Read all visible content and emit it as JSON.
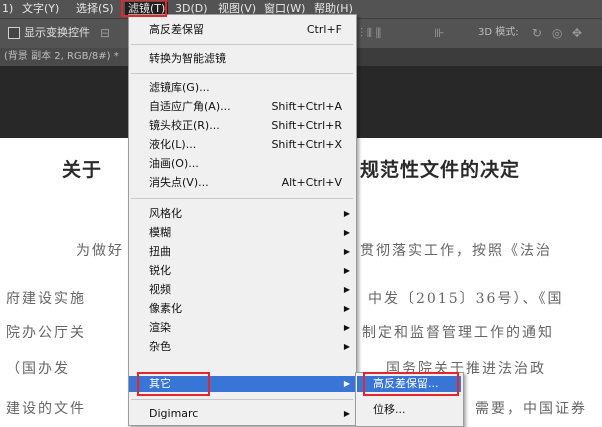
{
  "menubar": {
    "items": [
      "1)",
      "文字(Y)",
      "选择(S)",
      "滤镜(T)",
      "3D(D)",
      "视图(V)",
      "窗口(W)",
      "帮助(H)"
    ]
  },
  "options_bar": {
    "show_transform": "显示变换控件",
    "mode_label": "3D 模式:"
  },
  "doc_tab": "(背景 副本 2, RGB/8#) *",
  "document": {
    "title_left": "关于",
    "title_right": "规范性文件的决定",
    "lines": [
      {
        "left": "为做好",
        "right": "贯彻落实工作，按照《法治"
      },
      {
        "left": "府建设实施",
        "right": "中发〔2015〕36号）、《国"
      },
      {
        "left": "院办公厅关",
        "right": "制定和监督管理工作的通知"
      },
      {
        "left": "（国办发",
        "right": "国务院关于推进法治政"
      },
      {
        "left": "建设的文件",
        "right": "需要，中国证券"
      }
    ]
  },
  "filter_menu": {
    "items": [
      {
        "label": "高反差保留",
        "shortcut": "Ctrl+F"
      },
      {
        "label": "转换为智能滤镜"
      },
      {
        "label": "滤镜库(G)..."
      },
      {
        "label": "自适应广角(A)...",
        "shortcut": "Shift+Ctrl+A"
      },
      {
        "label": "镜头校正(R)...",
        "shortcut": "Shift+Ctrl+R"
      },
      {
        "label": "液化(L)...",
        "shortcut": "Shift+Ctrl+X"
      },
      {
        "label": "油画(O)..."
      },
      {
        "label": "消失点(V)...",
        "shortcut": "Alt+Ctrl+V"
      },
      {
        "label": "风格化",
        "submenu": true
      },
      {
        "label": "模糊",
        "submenu": true
      },
      {
        "label": "扭曲",
        "submenu": true
      },
      {
        "label": "锐化",
        "submenu": true
      },
      {
        "label": "视频",
        "submenu": true
      },
      {
        "label": "像素化",
        "submenu": true
      },
      {
        "label": "渲染",
        "submenu": true
      },
      {
        "label": "杂色",
        "submenu": true
      },
      {
        "label": "其它",
        "submenu": true,
        "highlighted": true
      },
      {
        "label": "Digimarc",
        "submenu": true
      }
    ]
  },
  "submenu_other": {
    "items": [
      {
        "label": "高反差保留...",
        "highlighted": true
      },
      {
        "label": "位移..."
      }
    ]
  },
  "colors": {
    "highlight": "#3875d7",
    "annotation_red": "#e8262a",
    "menubar_bg": "#535353",
    "workspace_bg": "#282828"
  },
  "icons": [
    "transform-icon",
    "align-icons",
    "3d-rotate-icon",
    "3d-roll-icon",
    "3d-pan-icon",
    "submenu-arrow-icon"
  ]
}
